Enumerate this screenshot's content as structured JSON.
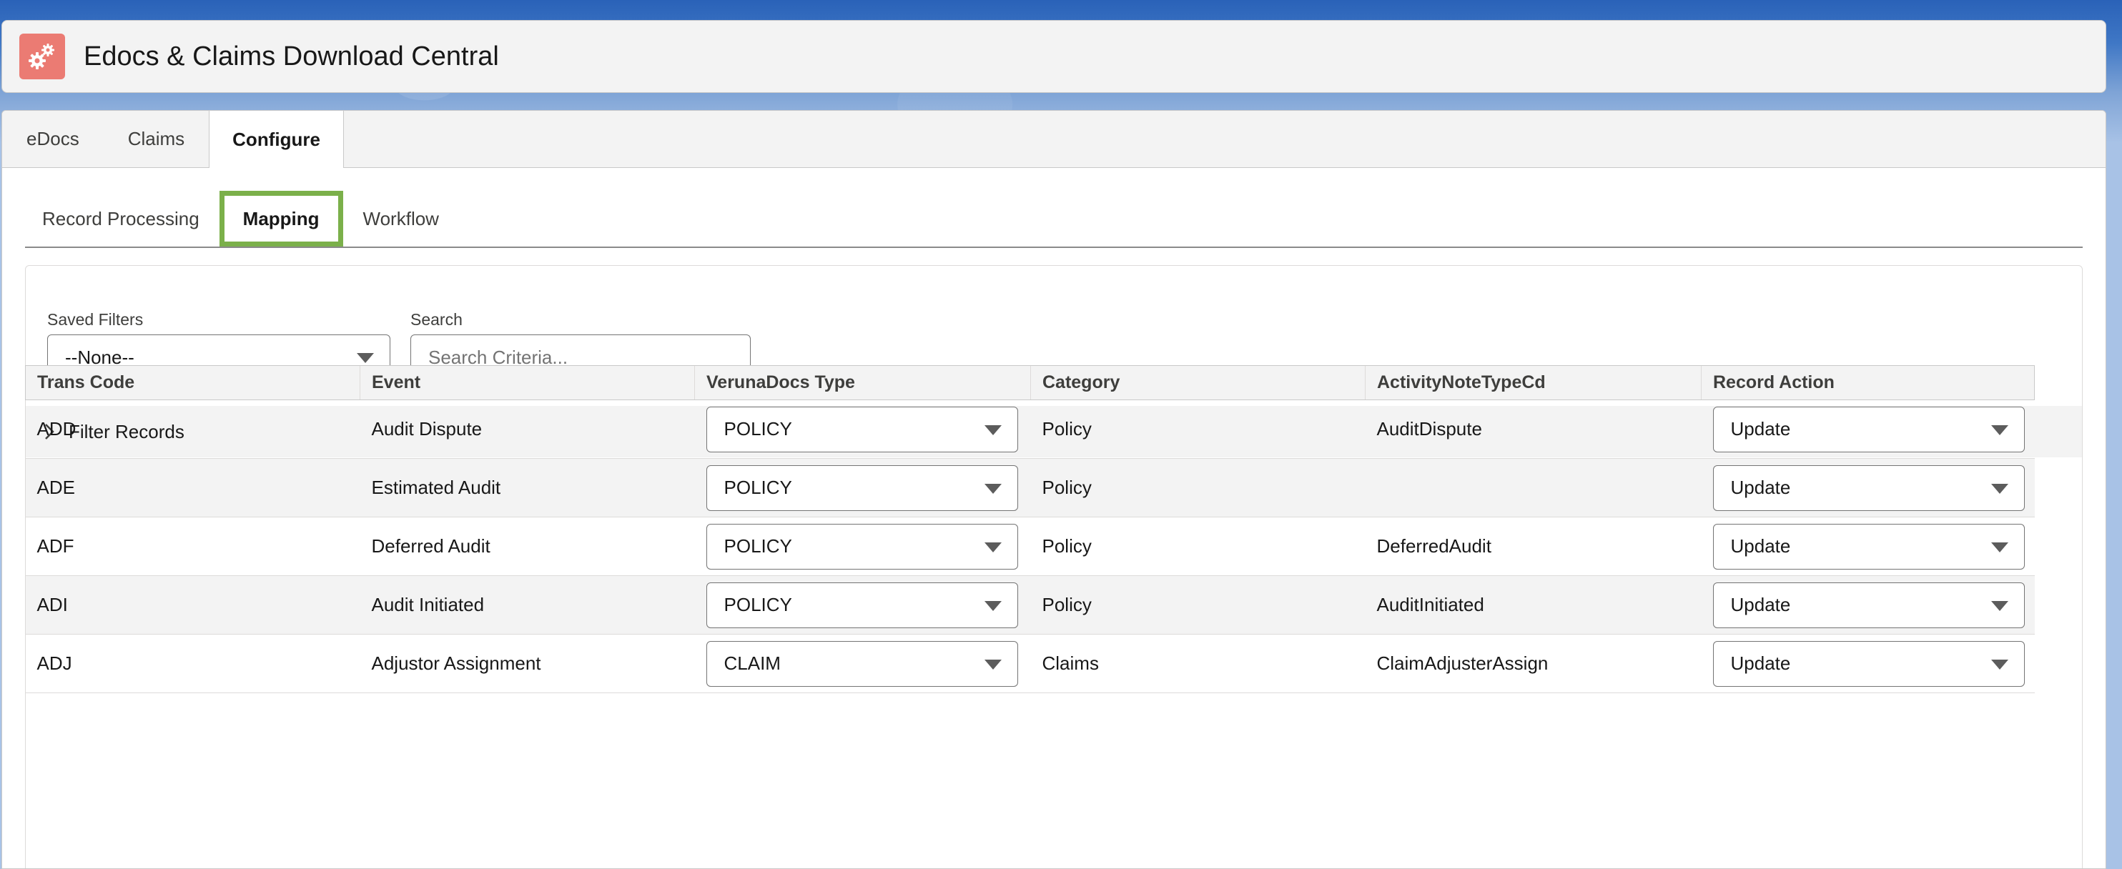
{
  "app": {
    "title": "Edocs & Claims Download Central",
    "icon": "gears-icon",
    "icon_color": "#eb7b73"
  },
  "top_tabs": [
    {
      "label": "eDocs",
      "active": false
    },
    {
      "label": "Claims",
      "active": false
    },
    {
      "label": "Configure",
      "active": true
    }
  ],
  "sub_tabs": [
    {
      "label": "Record Processing",
      "active": false
    },
    {
      "label": "Mapping",
      "active": true
    },
    {
      "label": "Workflow",
      "active": false
    }
  ],
  "highlight_color": "#7bb04a",
  "filters": {
    "saved_filters_label": "Saved Filters",
    "saved_filters_value": "--None--",
    "search_label": "Search",
    "search_placeholder": "Search Criteria...",
    "filter_records_label": "Filter Records"
  },
  "table": {
    "columns": [
      "Trans Code",
      "Event",
      "VerunaDocs Type",
      "Category",
      "ActivityNoteTypeCd",
      "Record Action"
    ],
    "rows": [
      {
        "trans_code": "ADD",
        "event": "Audit Dispute",
        "docs_type": "POLICY",
        "category": "Policy",
        "activity_note": "AuditDispute",
        "record_action": "Update"
      },
      {
        "trans_code": "ADE",
        "event": "Estimated Audit",
        "docs_type": "POLICY",
        "category": "Policy",
        "activity_note": "",
        "record_action": "Update"
      },
      {
        "trans_code": "ADF",
        "event": "Deferred Audit",
        "docs_type": "POLICY",
        "category": "Policy",
        "activity_note": "DeferredAudit",
        "record_action": "Update"
      },
      {
        "trans_code": "ADI",
        "event": "Audit Initiated",
        "docs_type": "POLICY",
        "category": "Policy",
        "activity_note": "AuditInitiated",
        "record_action": "Update"
      },
      {
        "trans_code": "ADJ",
        "event": "Adjustor Assignment",
        "docs_type": "CLAIM",
        "category": "Claims",
        "activity_note": "ClaimAdjusterAssign",
        "record_action": "Update"
      }
    ]
  }
}
